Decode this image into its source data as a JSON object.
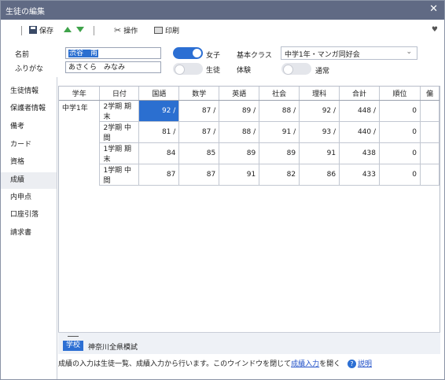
{
  "window": {
    "title": "生徒の編集",
    "close_glyph": "✕"
  },
  "toolbar": {
    "save_label": "保存",
    "tools_label": "操作",
    "print_label": "印刷",
    "heart_glyph": "♥"
  },
  "form": {
    "name_label": "名前",
    "name_value": "渋谷　南",
    "kana_label": "ふりがな",
    "kana_value": "あさくら　みなみ",
    "gender_female_label": "女子",
    "status_label": "生徒",
    "class_label": "基本クラス",
    "class_value": "中学1年・マンガ同好会",
    "trial_label": "体験",
    "normal_label": "通常"
  },
  "sidebar": {
    "items": [
      {
        "label": "生徒情報"
      },
      {
        "label": "保護者情報"
      },
      {
        "label": "備考"
      },
      {
        "label": "カード"
      },
      {
        "label": "資格"
      },
      {
        "label": "成績",
        "active": true
      },
      {
        "label": "内申点"
      },
      {
        "label": "口座引落"
      },
      {
        "label": "請求書"
      }
    ]
  },
  "grid": {
    "headers": [
      "学年",
      "日付",
      "国語",
      "数学",
      "英語",
      "社会",
      "理科",
      "合計",
      "順位",
      "偏"
    ],
    "grade_label": "中学1年",
    "rows": [
      {
        "date": "2学期 期末",
        "values": [
          "92 /",
          "87 /",
          "89 /",
          "88 /",
          "92 /",
          "448 /",
          "0"
        ]
      },
      {
        "date": "2学期 中間",
        "values": [
          "81 /",
          "87 /",
          "88 /",
          "91 /",
          "93 /",
          "440 /",
          "0"
        ]
      },
      {
        "date": "1学期 期末",
        "values": [
          "84",
          "85",
          "89",
          "89",
          "91",
          "438",
          "0"
        ]
      },
      {
        "date": "1学期 中間",
        "values": [
          "87",
          "87",
          "91",
          "82",
          "86",
          "433",
          "0"
        ]
      }
    ]
  },
  "bottom": {
    "tag": "学校",
    "school": "神奈川全県模試"
  },
  "footer": {
    "text": "成績の入力は生徒一覧、成績入力から行います。このウインドウを閉じて",
    "link": "成績入力",
    "text2": "を開く",
    "help_glyph": "?",
    "help_link": "説明"
  }
}
